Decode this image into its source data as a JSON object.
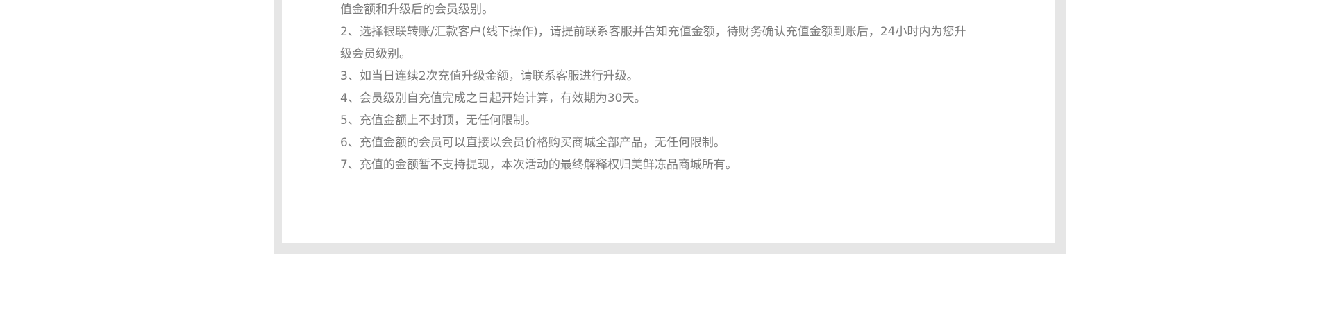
{
  "rules": {
    "lines": [
      "值金额和升级后的会员级别。",
      "2、选择银联转账/汇款客户(线下操作)，请提前联系客服并告知充值金额，待财务确认充值金额到账后，24小时内为您升",
      "级会员级别。",
      "3、如当日连续2次充值升级金额，请联系客服进行升级。",
      "4、会员级别自充值完成之日起开始计算，有效期为30天。",
      "5、充值金额上不封顶，无任何限制。",
      "6、充值金额的会员可以直接以会员价格购买商城全部产品，无任何限制。",
      "7、充值的金额暂不支持提现，本次活动的最终解释权归美鲜冻品商城所有。"
    ]
  }
}
